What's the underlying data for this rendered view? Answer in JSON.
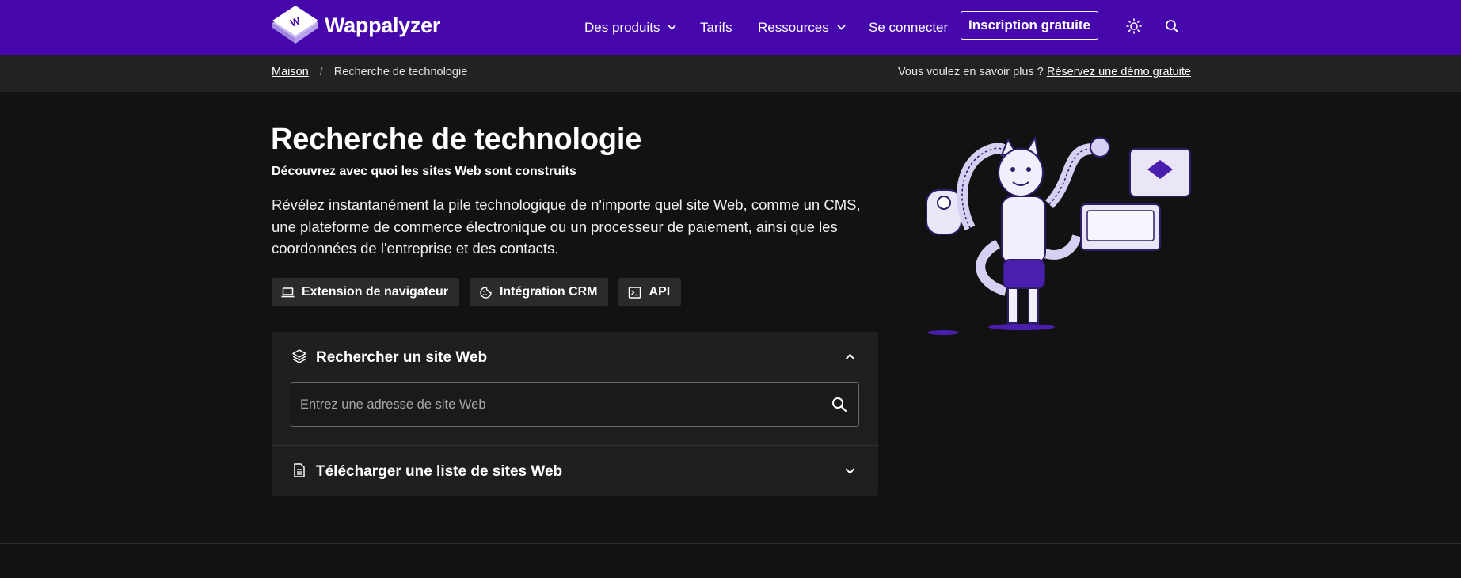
{
  "brand": {
    "name": "Wappalyzer",
    "accent": "#4608ad"
  },
  "nav": {
    "products": "Des produits",
    "pricing": "Tarifs",
    "resources": "Ressources",
    "login": "Se connecter",
    "signup": "Inscription gratuite"
  },
  "breadcrumb": {
    "home": "Maison",
    "current": "Recherche de technologie",
    "separator": "/"
  },
  "promo": {
    "text": "Vous voulez en savoir plus ?",
    "link": "Réservez une démo gratuite"
  },
  "hero": {
    "title": "Recherche de technologie",
    "subtitle": "Découvrez avec quoi les sites Web sont construits",
    "description": "Révélez instantanément la pile technologique de n'importe quel site Web, comme un CMS, une plateforme de commerce électronique ou un processeur de paiement, ainsi que les coordonnées de l'entreprise et des contacts."
  },
  "chips": [
    {
      "label": "Extension de navigateur",
      "icon": "laptop-icon"
    },
    {
      "label": "Intégration CRM",
      "icon": "cookie-icon"
    },
    {
      "label": "API",
      "icon": "terminal-icon"
    }
  ],
  "lookup": {
    "title": "Rechercher un site Web",
    "placeholder": "Entrez une adresse de site Web",
    "upload_title": "Télécharger une liste de sites Web"
  }
}
